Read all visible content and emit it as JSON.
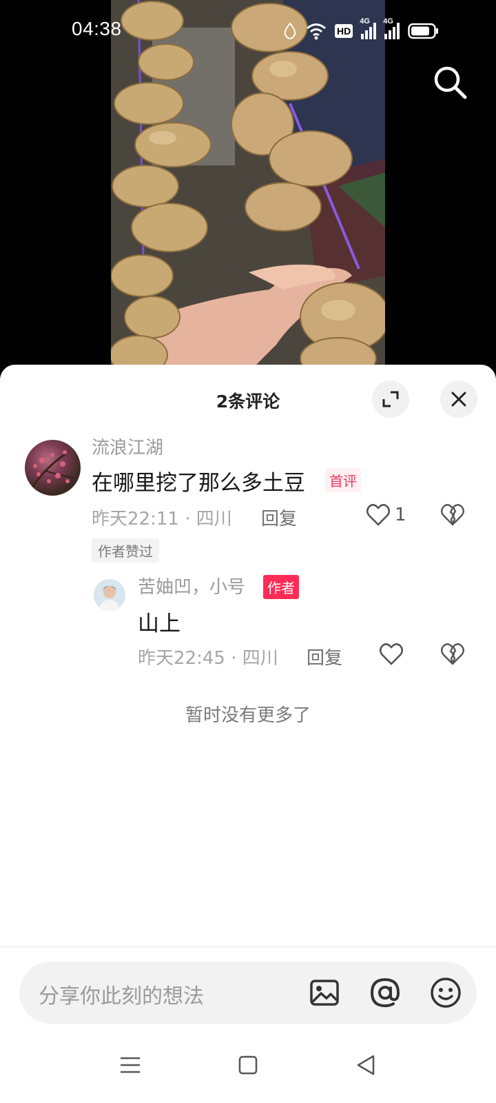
{
  "status_bar": {
    "time": "04:38",
    "hd_label": "HD",
    "net_1": "4G",
    "net_2": "4G"
  },
  "video": {
    "description_icon": "video-frame"
  },
  "sheet": {
    "title": "2条评论"
  },
  "comments": [
    {
      "user": "流浪江湖",
      "text": "在哪里挖了那么多土豆",
      "badge": "首评",
      "meta": "昨天22:11 · 四川",
      "reply_label": "回复",
      "likes": "1",
      "liked_tag": "作者赞过",
      "replies": [
        {
          "user": "苦妯凹，小号",
          "badge": "作者",
          "text": "山上",
          "meta": "昨天22:45 · 四川",
          "reply_label": "回复"
        }
      ]
    }
  ],
  "no_more": "暂时没有更多了",
  "input": {
    "placeholder": "分享你此刻的想法"
  },
  "colors": {
    "accent": "#fe2c55",
    "first_tag": "#e8395e"
  }
}
